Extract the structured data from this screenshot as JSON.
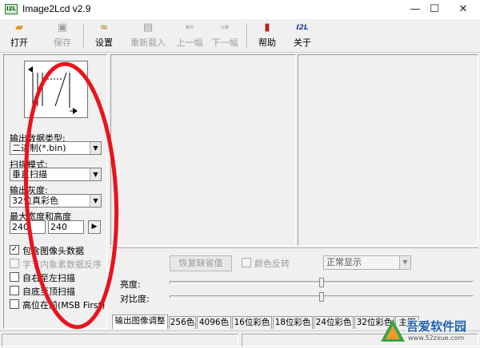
{
  "window": {
    "icon_text": "I2L",
    "title": "Image2Lcd v2.9",
    "controls": {
      "minimize": "—",
      "maximize": "☐",
      "close": "✕"
    }
  },
  "toolbar": {
    "buttons": [
      {
        "label": "打开",
        "icon": "open-folder-icon",
        "glyph": "📂",
        "enabled": true
      },
      {
        "label": "保存",
        "icon": "save-disk-icon",
        "glyph": "💾",
        "enabled": false
      },
      {
        "label": "设置",
        "icon": "glasses-icon",
        "glyph": "👓",
        "enabled": true
      },
      {
        "label": "重新载入",
        "icon": "reload-icon",
        "glyph": "⟲",
        "enabled": false
      },
      {
        "label": "上一幅",
        "icon": "prev-image-icon",
        "glyph": "⇐",
        "enabled": false
      },
      {
        "label": "下一幅",
        "icon": "next-image-icon",
        "glyph": "⇒",
        "enabled": false
      },
      {
        "label": "帮助",
        "icon": "help-book-icon",
        "glyph": "📕",
        "enabled": true
      },
      {
        "label": "关于",
        "icon": "about-logo-icon",
        "glyph": "I2L",
        "enabled": true
      }
    ]
  },
  "settings": {
    "output_type_label": "输出数据类型:",
    "output_type_value": "二进制(*.bin)",
    "scan_mode_label": "扫描模式:",
    "scan_mode_value": "垂直扫描",
    "gray_label": "输出灰度:",
    "gray_value": "32位真彩色",
    "max_size_label": "最大宽度和高度",
    "max_width": "240",
    "max_height": "240",
    "apply_arrow": "▶"
  },
  "options": [
    {
      "label": "包含图像头数据",
      "checked": true,
      "enabled": true
    },
    {
      "label": "字节内象素数据反序",
      "checked": false,
      "enabled": false
    },
    {
      "label": "自右至左扫描",
      "checked": false,
      "enabled": true
    },
    {
      "label": "自底至顶扫描",
      "checked": false,
      "enabled": true
    },
    {
      "label": "高位在前(MSB First)",
      "checked": false,
      "enabled": true
    }
  ],
  "adjust": {
    "restore_button": "恢复缺省值",
    "invert_label": "颜色反转",
    "display_mode": "正常显示",
    "brightness_label": "亮度:",
    "contrast_label": "对比度:",
    "brightness_level": 0.5,
    "contrast_level": 0.5
  },
  "tabs": [
    "输出图像调整",
    "256色",
    "4096色",
    "16位彩色",
    "18位彩色",
    "24位彩色",
    "32位彩色",
    "主图"
  ],
  "watermark": {
    "brand": "吾爱软件园",
    "url": "www.52zxue.com"
  },
  "colors": {
    "annotation_ellipse": "#e8141c",
    "icon_open": "#d4a017",
    "icon_help": "#b22222",
    "icon_about": "#1f3f8f"
  }
}
